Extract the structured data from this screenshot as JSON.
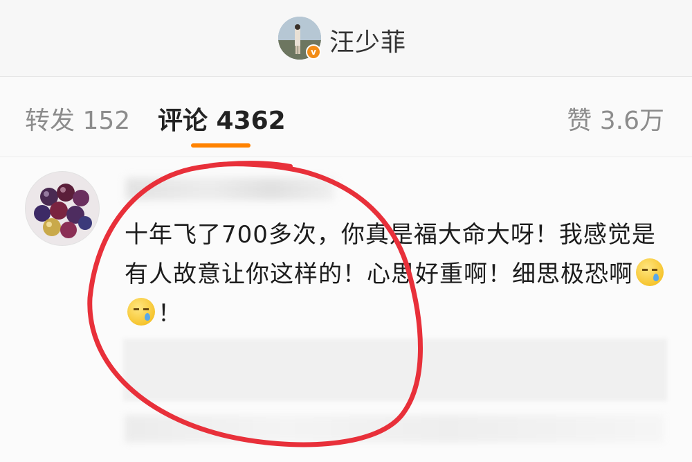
{
  "header": {
    "username": "汪少菲",
    "verified_mark": "v"
  },
  "tabs": {
    "repost": "转发 152",
    "comments": "评论 4362",
    "likes": "赞 3.6万"
  },
  "comment": {
    "text_before_emoji": "十年飞了700多次，你真是福大命大呀！我感觉是有人故意让你这样的！心思好重啊！细思极恐啊",
    "text_after_emoji": "！",
    "emoji": [
      "sweat-face-icon",
      "sweat-face-icon"
    ]
  },
  "colors": {
    "accent": "#ff8200",
    "verified": "#f28c16",
    "annotation": "#e8303a"
  }
}
